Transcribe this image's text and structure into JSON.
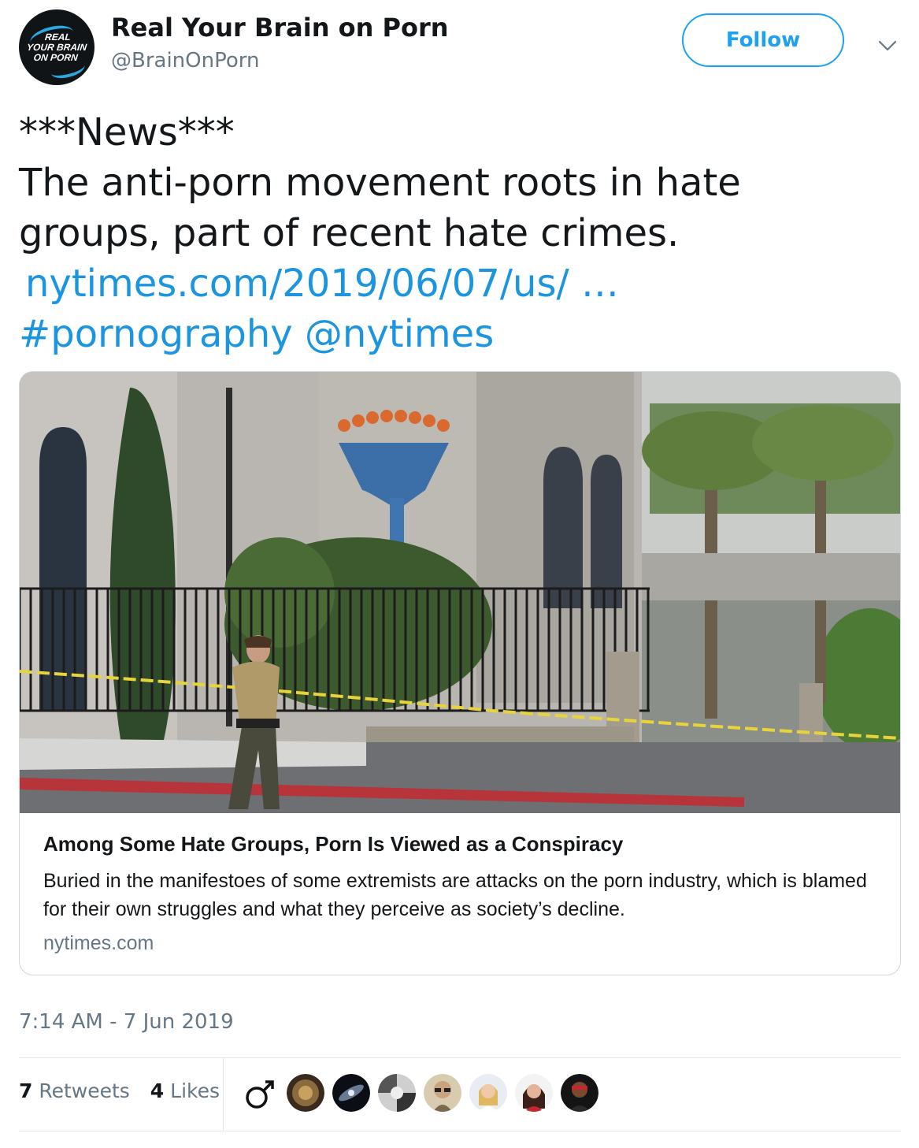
{
  "author": {
    "display_name": "Real Your Brain on Porn",
    "handle": "@BrainOnPorn",
    "avatar_text_line1": "REAL",
    "avatar_text_line2": "YOUR BRAIN",
    "avatar_text_line3": "ON PORN"
  },
  "follow_label": "Follow",
  "tweet": {
    "line1": "***News***",
    "line2": "The anti-porn movement roots in hate",
    "line3": "groups, part of recent hate crimes.",
    "link_text": "nytimes.com/2019/06/07/us/ …",
    "hashtag": "#pornography",
    "mention": "@nytimes"
  },
  "card": {
    "title": "Among Some Hate Groups, Porn Is Viewed as a Conspiracy",
    "description": "Buried in the manifestoes of some extremists are attacks on the porn industry, which is blamed for their own struggles and what they perceive as society’s decline.",
    "domain": "nytimes.com"
  },
  "timestamp": "7:14 AM - 7 Jun 2019",
  "stats": {
    "retweets_count": "7",
    "retweets_label": "Retweets",
    "likes_count": "4",
    "likes_label": "Likes"
  },
  "colors": {
    "link": "#1b95e0",
    "follow": "#1da1f2",
    "muted": "#657786",
    "text": "#14171a"
  }
}
